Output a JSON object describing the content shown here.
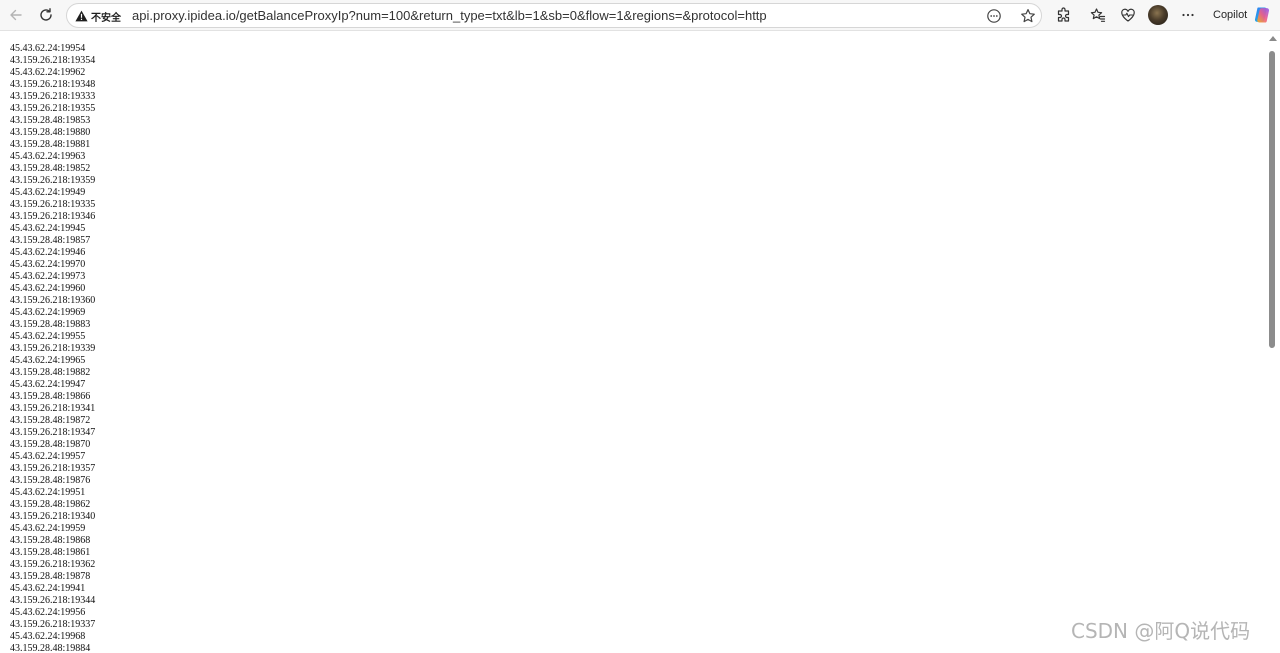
{
  "browser": {
    "security_label": "不安全",
    "url": "api.proxy.ipidea.io/getBalanceProxyIp?num=100&return_type=txt&lb=1&sb=0&flow=1&regions=&protocol=http",
    "copilot_label": "Copilot",
    "icons": [
      "back-icon",
      "reload-icon",
      "warning-icon",
      "read-aloud-icon",
      "favorite-star-icon",
      "extensions-icon",
      "favorites-icon",
      "browser-essentials-icon",
      "profile-avatar",
      "more-icon",
      "copilot-icon"
    ]
  },
  "proxies": [
    "45.43.62.24:19954",
    "43.159.26.218:19354",
    "45.43.62.24:19962",
    "43.159.26.218:19348",
    "43.159.26.218:19333",
    "43.159.26.218:19355",
    "43.159.28.48:19853",
    "43.159.28.48:19880",
    "43.159.28.48:19881",
    "45.43.62.24:19963",
    "43.159.28.48:19852",
    "43.159.26.218:19359",
    "45.43.62.24:19949",
    "43.159.26.218:19335",
    "43.159.26.218:19346",
    "45.43.62.24:19945",
    "43.159.28.48:19857",
    "45.43.62.24:19946",
    "45.43.62.24:19970",
    "45.43.62.24:19973",
    "45.43.62.24:19960",
    "43.159.26.218:19360",
    "45.43.62.24:19969",
    "43.159.28.48:19883",
    "45.43.62.24:19955",
    "43.159.26.218:19339",
    "45.43.62.24:19965",
    "43.159.28.48:19882",
    "45.43.62.24:19947",
    "43.159.28.48:19866",
    "43.159.26.218:19341",
    "43.159.28.48:19872",
    "43.159.26.218:19347",
    "43.159.28.48:19870",
    "45.43.62.24:19957",
    "43.159.26.218:19357",
    "43.159.28.48:19876",
    "45.43.62.24:19951",
    "43.159.28.48:19862",
    "43.159.26.218:19340",
    "45.43.62.24:19959",
    "43.159.28.48:19868",
    "43.159.28.48:19861",
    "43.159.26.218:19362",
    "43.159.28.48:19878",
    "45.43.62.24:19941",
    "43.159.26.218:19344",
    "45.43.62.24:19956",
    "43.159.26.218:19337",
    "45.43.62.24:19968",
    "43.159.28.48:19884"
  ],
  "watermark": "CSDN @阿Q说代码",
  "colors": {
    "warning": "#1f1f1f",
    "text": "#111111",
    "scrollbar_thumb": "#8c8c8c"
  }
}
